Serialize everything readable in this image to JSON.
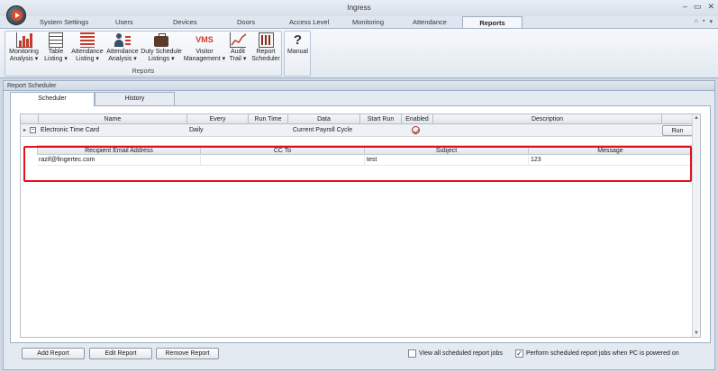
{
  "window": {
    "title": "Ingress",
    "controls": [
      "–",
      "▭",
      "✕"
    ]
  },
  "menu": {
    "tabs": [
      {
        "label": "System Settings"
      },
      {
        "label": "Users"
      },
      {
        "label": "Devices"
      },
      {
        "label": "Doors"
      },
      {
        "label": "Access Level"
      },
      {
        "label": "Monitoring"
      },
      {
        "label": "Attendance"
      },
      {
        "label": "Reports"
      }
    ],
    "active_tab": "Reports",
    "right_icons": [
      "⌂",
      "▪",
      "▾"
    ]
  },
  "ribbon": {
    "buttons": [
      {
        "line1": "Monitoring",
        "line2": "Analysis ▾",
        "icon": "monitoring-chart-icon"
      },
      {
        "line1": "Table",
        "line2": "Listing ▾",
        "icon": "table-icon"
      },
      {
        "line1": "Attendance",
        "line2": "Listing ▾",
        "icon": "list-icon"
      },
      {
        "line1": "Attendance",
        "line2": "Analysis ▾",
        "icon": "person-analysis-icon"
      },
      {
        "line1": "Duty Schedule",
        "line2": "Listings ▾",
        "icon": "briefcase-icon"
      },
      {
        "line1": "Visitor",
        "line2": "Management ▾",
        "icon": "vms-icon",
        "icon_text": "VMS"
      },
      {
        "line1": "Audit",
        "line2": "Trail ▾",
        "icon": "trend-chart-icon"
      },
      {
        "line1": "Report",
        "line2": "Scheduler",
        "icon": "scheduler-icon"
      }
    ],
    "group_label": "Reports",
    "manual": {
      "label": "Manual",
      "icon_text": "?"
    }
  },
  "panel": {
    "title": "Report Scheduler",
    "tabs": [
      {
        "label": "Scheduler"
      },
      {
        "label": "History"
      }
    ],
    "active_tab": "Scheduler"
  },
  "grid": {
    "columns": [
      "Name",
      "Every",
      "Run Time",
      "Data",
      "Start Run",
      "Enabled",
      "Description"
    ],
    "row": {
      "name": "Electronic Time Card",
      "every": "Daily",
      "run_time": "",
      "data": "Current Payroll Cycle",
      "start_run": "",
      "enabled": true,
      "description": "",
      "run_label": "Run",
      "expander": "▸",
      "collapse_glyph": "−"
    },
    "detail": {
      "columns": [
        "Recipient Email Address",
        "CC To",
        "Subject",
        "Message"
      ],
      "row": [
        "razif@fingertec.com",
        "",
        "test",
        "123"
      ]
    }
  },
  "footer": {
    "buttons": [
      "Add Report",
      "Edit Report",
      "Remove Report"
    ],
    "view_all": {
      "label": "View all scheduled report jobs",
      "checked": false
    },
    "perform_when_on": {
      "label": "Perform scheduled report jobs when PC is powered on",
      "checked": true,
      "check_glyph": "✓"
    }
  },
  "colors": {
    "highlight_border": "#e3101c",
    "brand_orb": "#e04a24",
    "vms_text": "#d23a2a"
  }
}
